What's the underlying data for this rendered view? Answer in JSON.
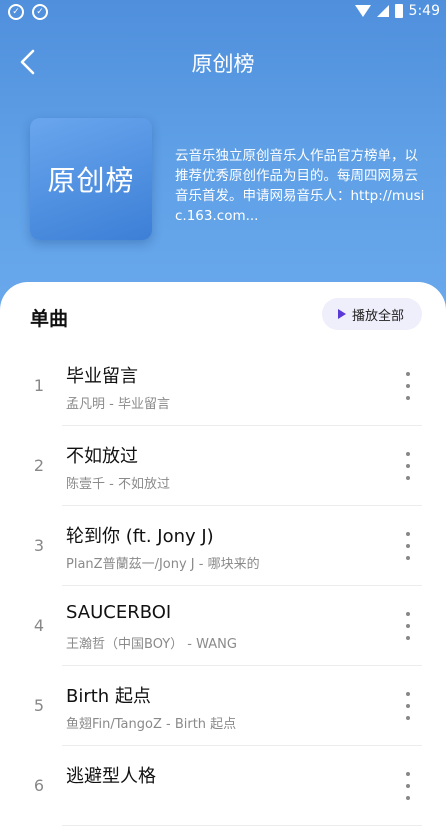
{
  "status_bar": {
    "time": "5:49"
  },
  "header": {
    "title": "原创榜"
  },
  "playlist": {
    "cover_text": "原创榜",
    "description": "云音乐独立原创音乐人作品官方榜单，以推荐优秀原创作品为目的。每周四网易云音乐首发。申请网易音乐人：http://music.163.com..."
  },
  "section": {
    "title": "单曲",
    "play_all_label": "播放全部"
  },
  "songs": [
    {
      "index": "1",
      "name": "毕业留言",
      "subtitle": "孟凡明 - 毕业留言"
    },
    {
      "index": "2",
      "name": "不如放过",
      "subtitle": "陈壹千 - 不如放过"
    },
    {
      "index": "3",
      "name": "轮到你 (ft. Jony J)",
      "subtitle": "PlanZ普蘭茲一/Jony J - 哪块来的"
    },
    {
      "index": "4",
      "name": "SAUCERBOI",
      "subtitle": "王瀚哲（中国BOY） - WANG"
    },
    {
      "index": "5",
      "name": "Birth 起点",
      "subtitle": "鱼翅Fin/TangoZ - Birth 起点"
    },
    {
      "index": "6",
      "name": "逃避型人格",
      "subtitle": ""
    }
  ]
}
